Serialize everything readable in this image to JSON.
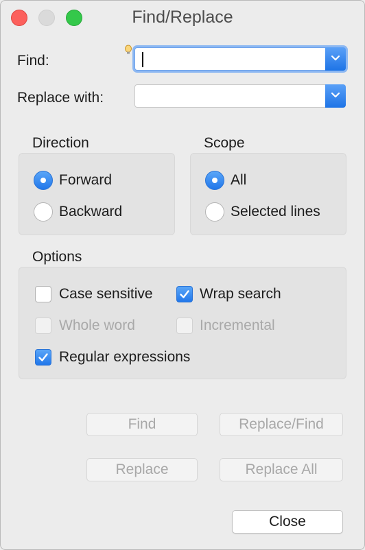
{
  "window": {
    "title": "Find/Replace"
  },
  "find": {
    "label": "Find:",
    "value": ""
  },
  "replace": {
    "label": "Replace with:",
    "value": ""
  },
  "direction": {
    "title": "Direction",
    "options": [
      {
        "label": "Forward",
        "selected": true
      },
      {
        "label": "Backward",
        "selected": false
      }
    ]
  },
  "scope": {
    "title": "Scope",
    "options": [
      {
        "label": "All",
        "selected": true
      },
      {
        "label": "Selected lines",
        "selected": false
      }
    ]
  },
  "options": {
    "title": "Options",
    "items": [
      {
        "label": "Case sensitive",
        "checked": false,
        "enabled": true
      },
      {
        "label": "Wrap search",
        "checked": true,
        "enabled": true
      },
      {
        "label": "Whole word",
        "checked": false,
        "enabled": false
      },
      {
        "label": "Incremental",
        "checked": false,
        "enabled": false
      },
      {
        "label": "Regular expressions",
        "checked": true,
        "enabled": true
      }
    ]
  },
  "buttons": {
    "find": "Find",
    "replace_find": "Replace/Find",
    "replace": "Replace",
    "replace_all": "Replace All",
    "close": "Close"
  },
  "colors": {
    "accent": "#2177ea",
    "focus_ring": "#8db8f2",
    "close_light": "#fc605c",
    "zoom_light": "#34c84a"
  }
}
